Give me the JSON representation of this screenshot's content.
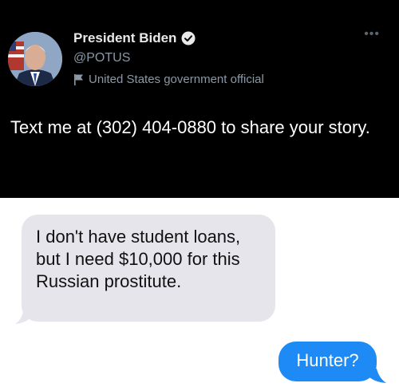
{
  "tweet": {
    "display_name": "President Biden",
    "handle": "@POTUS",
    "label": "United States government official",
    "more_icon": "•••",
    "text": "Text me at (302) 404-0880 to share your story."
  },
  "messages": {
    "received": "I don't have student loans, but I need $10,000 for this Russian prostitute.",
    "sent": "Hunter?"
  },
  "colors": {
    "tweet_bg": "#000000",
    "handle_gray": "#8b98a5",
    "received_bubble": "#e6e5eb",
    "sent_bubble": "#1e8af5"
  },
  "icons": {
    "verified": "verified-badge-icon",
    "label": "flag-icon",
    "more": "more-dots-icon"
  }
}
